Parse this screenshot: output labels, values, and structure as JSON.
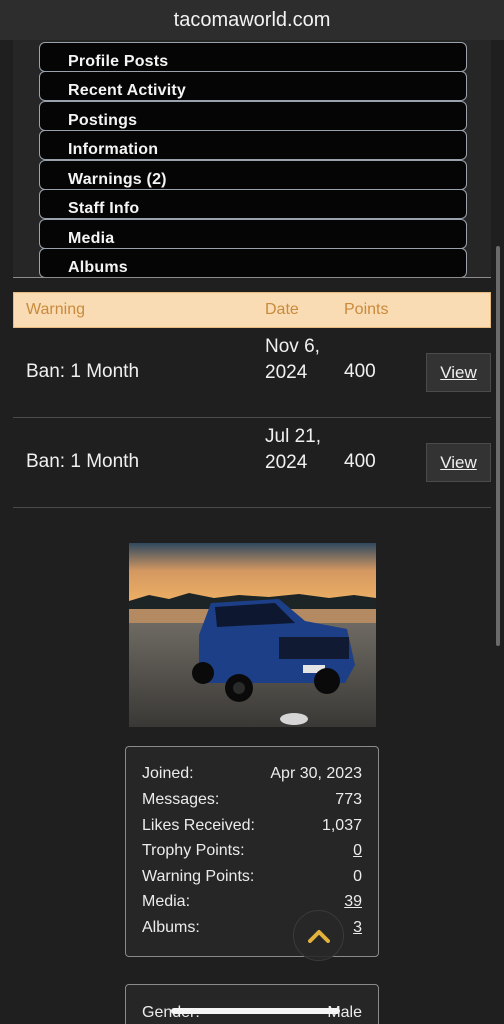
{
  "browser": {
    "url": "tacomaworld.com"
  },
  "tabs": [
    {
      "label": "Profile Posts"
    },
    {
      "label": "Recent Activity"
    },
    {
      "label": "Postings"
    },
    {
      "label": "Information"
    },
    {
      "label": "Warnings (2)"
    },
    {
      "label": "Staff Info"
    },
    {
      "label": "Media"
    },
    {
      "label": "Albums"
    }
  ],
  "warnings": {
    "headers": {
      "warning": "Warning",
      "date": "Date",
      "points": "Points"
    },
    "rows": [
      {
        "reason": "Ban: 1 Month",
        "date": "Nov 6, 2024",
        "points": "400",
        "action": "View"
      },
      {
        "reason": "Ban: 1 Month",
        "date": "Jul 21, 2024",
        "points": "400",
        "action": "View"
      }
    ]
  },
  "stats": [
    {
      "label": "Joined:",
      "value": "Apr 30, 2023"
    },
    {
      "label": "Messages:",
      "value": "773"
    },
    {
      "label": "Likes Received:",
      "value": "1,037"
    },
    {
      "label": "Trophy Points:",
      "value": "0"
    },
    {
      "label": "Warning Points:",
      "value": "0"
    },
    {
      "label": "Media:",
      "value": "39"
    },
    {
      "label": "Albums:",
      "value": "3"
    }
  ],
  "info": {
    "gender_label": "Gender:",
    "gender_value": "Male"
  },
  "icons": {
    "scroll_top": "chevron-up-icon"
  },
  "colors": {
    "accent": "#c98a3c",
    "header_bg": "#f9dcb3",
    "scroll_icon": "#e2b23c"
  }
}
